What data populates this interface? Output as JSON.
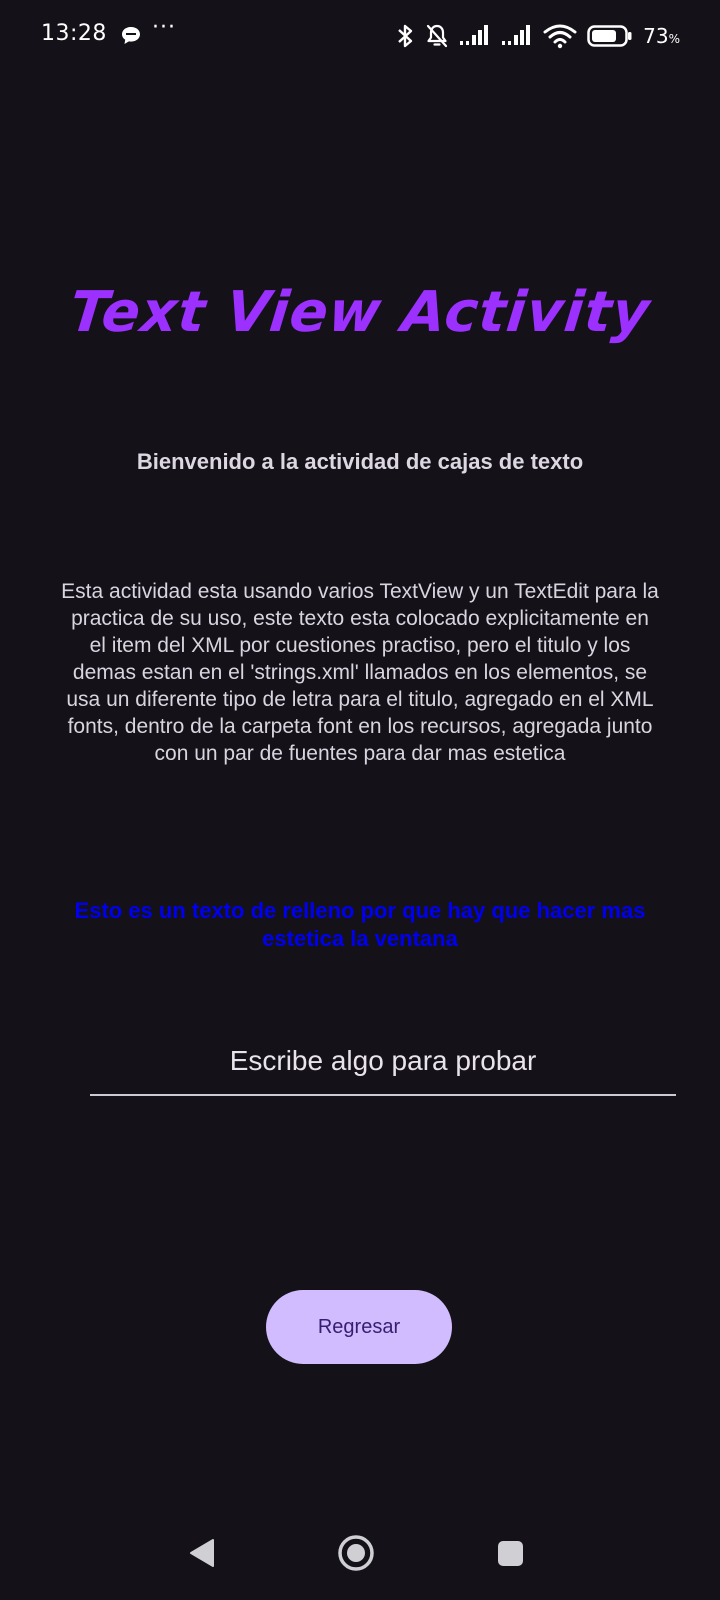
{
  "status_bar": {
    "time": "13:28",
    "overflow_dots": "···",
    "battery_percent": "73",
    "battery_symbol": "%",
    "icons": [
      "chat-bubble-icon",
      "overflow-dots-icon",
      "bluetooth-icon",
      "bell-off-icon",
      "signal-icon",
      "signal-icon",
      "wifi-icon",
      "battery-icon"
    ]
  },
  "main": {
    "title": "Text View Activity",
    "welcome": "Bienvenido a la actividad de cajas de texto",
    "description": "Esta actividad esta usando varios TextView y un TextEdit para la practica de su uso, este texto esta colocado explicitamente en el item del XML por cuestiones practiso, pero el titulo y los demas estan en el 'strings.xml' llamados en los elementos, se usa un diferente tipo de letra para el titulo, agregado en el XML fonts, dentro de la carpeta font en los recursos, agregada junto con un par de fuentes para dar mas estetica",
    "filler": "Esto es un texto de relleno por que hay que hacer mas estetica la ventana",
    "input": {
      "placeholder": "Escribe algo para probar",
      "value": ""
    },
    "back_button_label": "Regresar"
  },
  "nav_bar": {
    "icons": [
      "back-triangle-icon",
      "home-circle-icon",
      "recents-square-icon"
    ]
  },
  "colors": {
    "background": "#141218",
    "title": "#9b30ff",
    "filler_text": "#0000ee",
    "button_bg": "#d0bcff",
    "button_text": "#381e72"
  }
}
